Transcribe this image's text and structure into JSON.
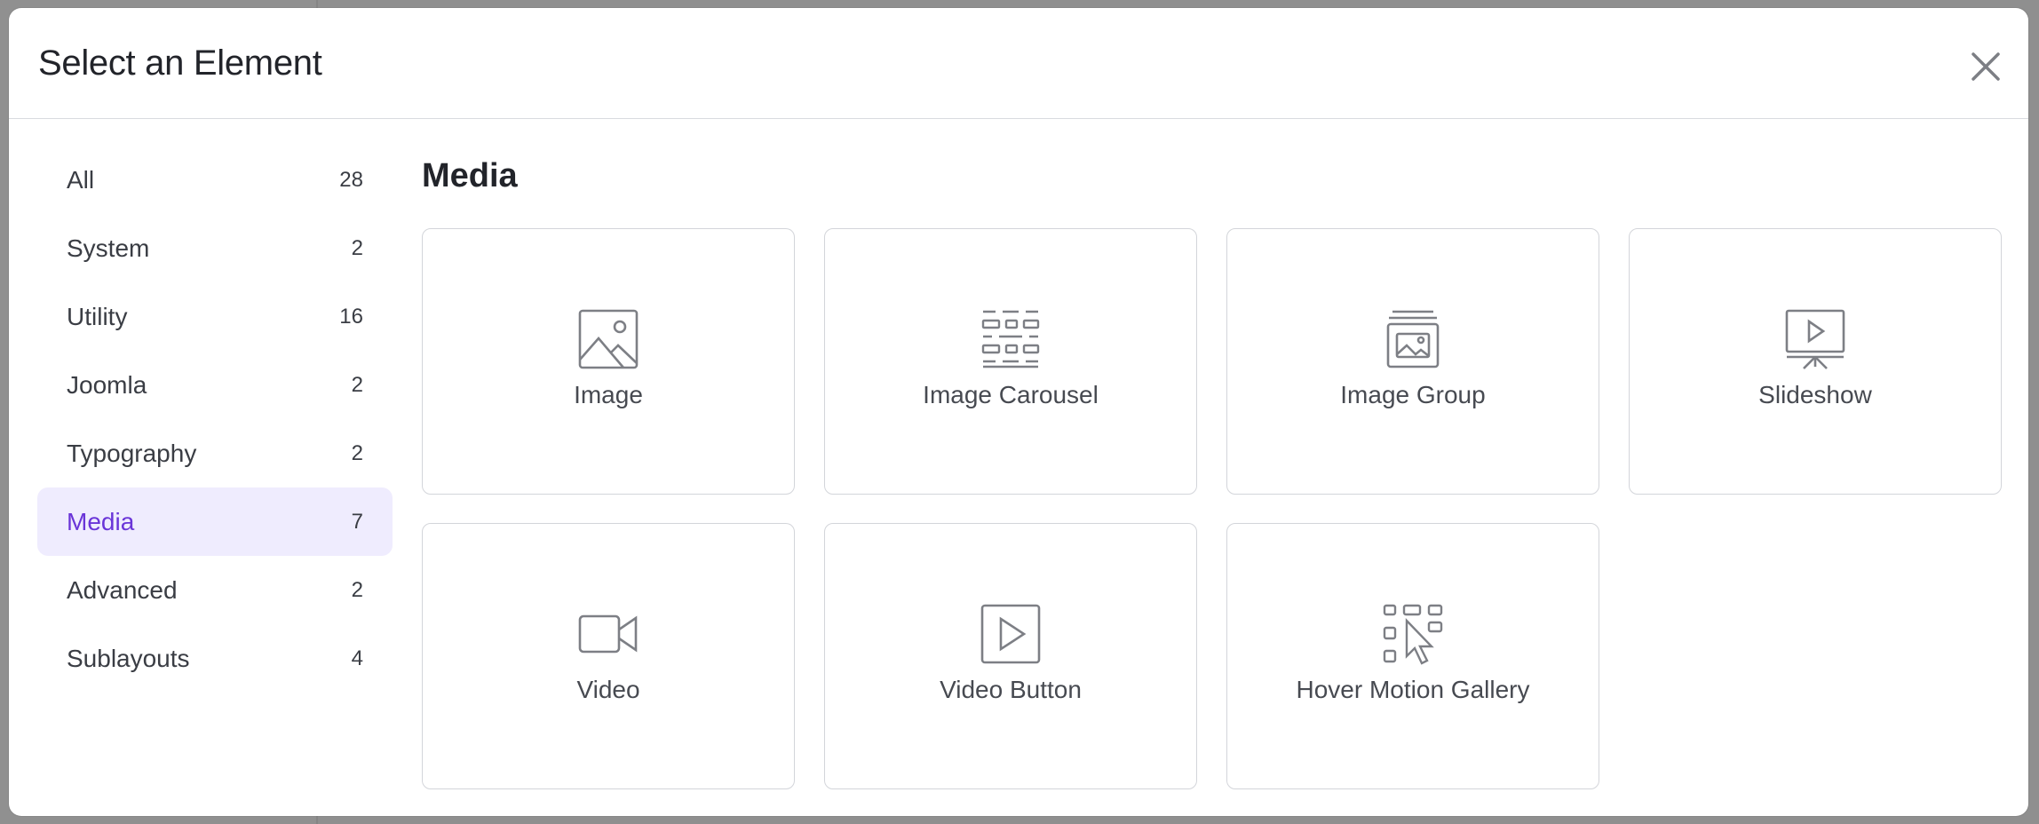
{
  "modal": {
    "title": "Select an Element"
  },
  "sidebar": {
    "items": [
      {
        "label": "All",
        "count": "28",
        "active": false
      },
      {
        "label": "System",
        "count": "2",
        "active": false
      },
      {
        "label": "Utility",
        "count": "16",
        "active": false
      },
      {
        "label": "Joomla",
        "count": "2",
        "active": false
      },
      {
        "label": "Typography",
        "count": "2",
        "active": false
      },
      {
        "label": "Media",
        "count": "7",
        "active": true
      },
      {
        "label": "Advanced",
        "count": "2",
        "active": false
      },
      {
        "label": "Sublayouts",
        "count": "4",
        "active": false
      }
    ]
  },
  "main": {
    "section_title": "Media",
    "elements": [
      {
        "label": "Image",
        "icon": "image-icon"
      },
      {
        "label": "Image Carousel",
        "icon": "brick-carousel-icon"
      },
      {
        "label": "Image Group",
        "icon": "image-group-icon"
      },
      {
        "label": "Slideshow",
        "icon": "presentation-slideshow-icon"
      },
      {
        "label": "Video",
        "icon": "video-camera-icon"
      },
      {
        "label": "Video Button",
        "icon": "play-button-icon"
      },
      {
        "label": "Hover Motion Gallery",
        "icon": "hover-gallery-cursor-icon"
      }
    ]
  },
  "colors": {
    "accent": "#6a35d8",
    "active_bg": "#efecfe",
    "icon_stroke": "#7d7f85"
  }
}
